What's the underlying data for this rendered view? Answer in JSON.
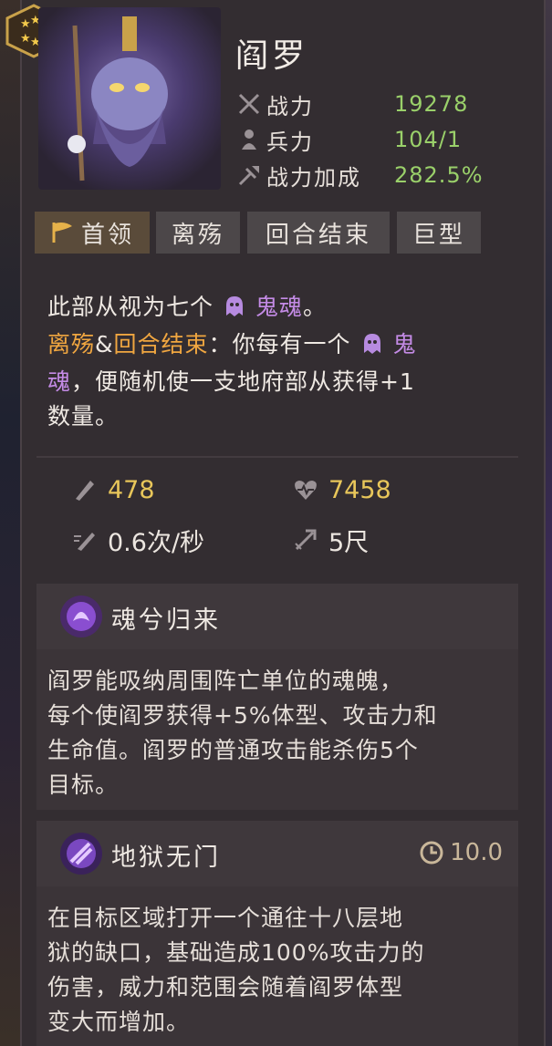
{
  "unit": {
    "name": "阎罗",
    "stars": 6,
    "stats": [
      {
        "icon": "crossed-swords-icon",
        "label": "战力",
        "value": "19278"
      },
      {
        "icon": "soldier-icon",
        "label": "兵力",
        "value": "104/1"
      },
      {
        "icon": "power-bonus-icon",
        "label": "战力加成",
        "value": "282.5%"
      }
    ]
  },
  "tags": [
    {
      "icon": "flag-icon",
      "label": "首领"
    },
    {
      "label": "离殇"
    },
    {
      "label": "回合结束"
    },
    {
      "label": "巨型"
    }
  ],
  "description": {
    "line1_pre": "此部从视为七个",
    "line1_ghost": "鬼魂",
    "line1_post": "。",
    "kw1": "离殇",
    "amp": "&",
    "kw2": "回合结束",
    "line2_mid": "：你每有一个",
    "line2_ghost_a": "鬼",
    "line3_ghost_b": "魂",
    "line3_post": "，便随机使一支地府部从获得+1",
    "line4": "数量。"
  },
  "attributes": {
    "attack": {
      "icon": "attack-icon",
      "value": "478"
    },
    "health": {
      "icon": "heart-icon",
      "value": "7458"
    },
    "attack_speed": {
      "icon": "attack-speed-icon",
      "value": "0.6次/秒"
    },
    "range": {
      "icon": "range-arrow-icon",
      "value": "5尺"
    }
  },
  "skills": [
    {
      "icon": "soul-return-icon",
      "name": "魂兮归来",
      "text_lines": [
        "阎罗能吸纳周围阵亡单位的魂魄，",
        "每个使阎罗获得+5%体型、攻击力和",
        "生命值。阎罗的普通攻击能杀伤5个",
        "目标。"
      ]
    },
    {
      "icon": "hell-gate-icon",
      "name": "地狱无门",
      "cooldown": "10.0",
      "text_lines": [
        "在目标区域打开一个通往十八层地",
        "狱的缺口，基础造成100%攻击力的",
        "伤害，威力和范围会随着阎罗体型",
        "变大而增加。"
      ]
    }
  ],
  "colors": {
    "stat_value": "#9ad06a",
    "keyword": "#f0a640",
    "ghost": "#c48be6",
    "attr_gold": "#e8c65a"
  }
}
